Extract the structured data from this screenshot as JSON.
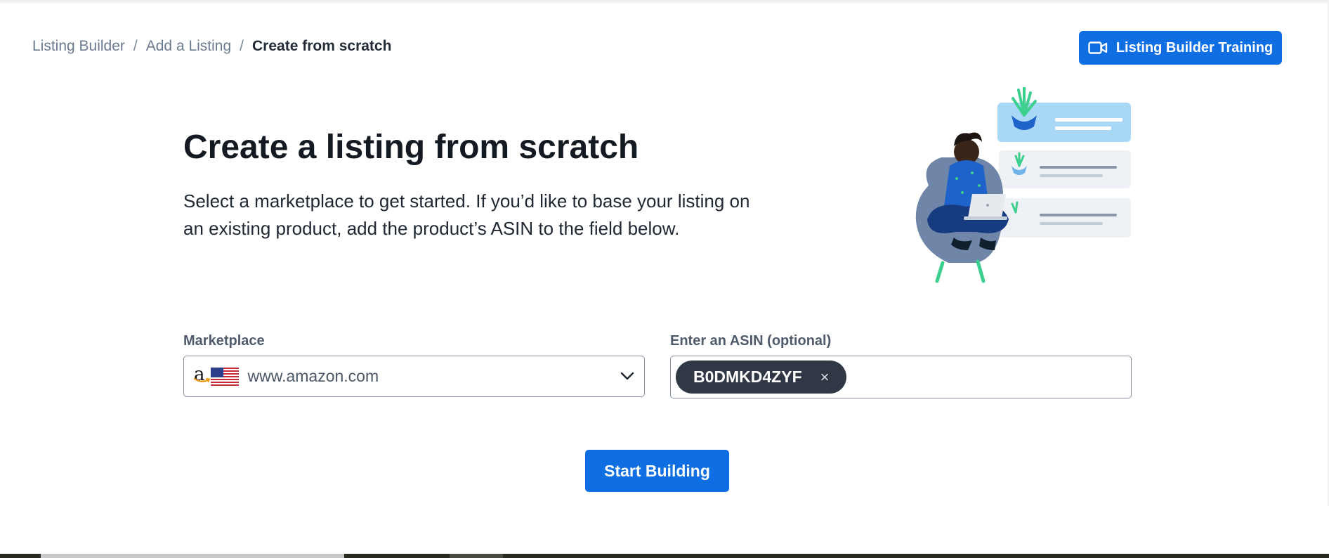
{
  "breadcrumb": {
    "items": [
      "Listing Builder",
      "Add a Listing"
    ],
    "separator": "/",
    "current": "Create from scratch"
  },
  "training_button": {
    "label": "Listing Builder Training",
    "icon": "video-camera-icon"
  },
  "header": {
    "title": "Create a listing from scratch",
    "description": "Select a marketplace to get started. If you’d like to base your listing on an existing product, add the product’s ASIN to the field below."
  },
  "marketplace": {
    "label": "Marketplace",
    "logo_letter": "a",
    "flag": "us-flag-icon",
    "value": "www.amazon.com"
  },
  "asin": {
    "label": "Enter an ASIN (optional)",
    "chips": [
      "B0DMKD4ZYF"
    ],
    "remove_glyph": "×"
  },
  "start_button": {
    "label": "Start Building"
  },
  "colors": {
    "primary": "#0f6ee1",
    "chip": "#2f3844",
    "text": "#1f2733",
    "muted": "#6b7a8e"
  }
}
